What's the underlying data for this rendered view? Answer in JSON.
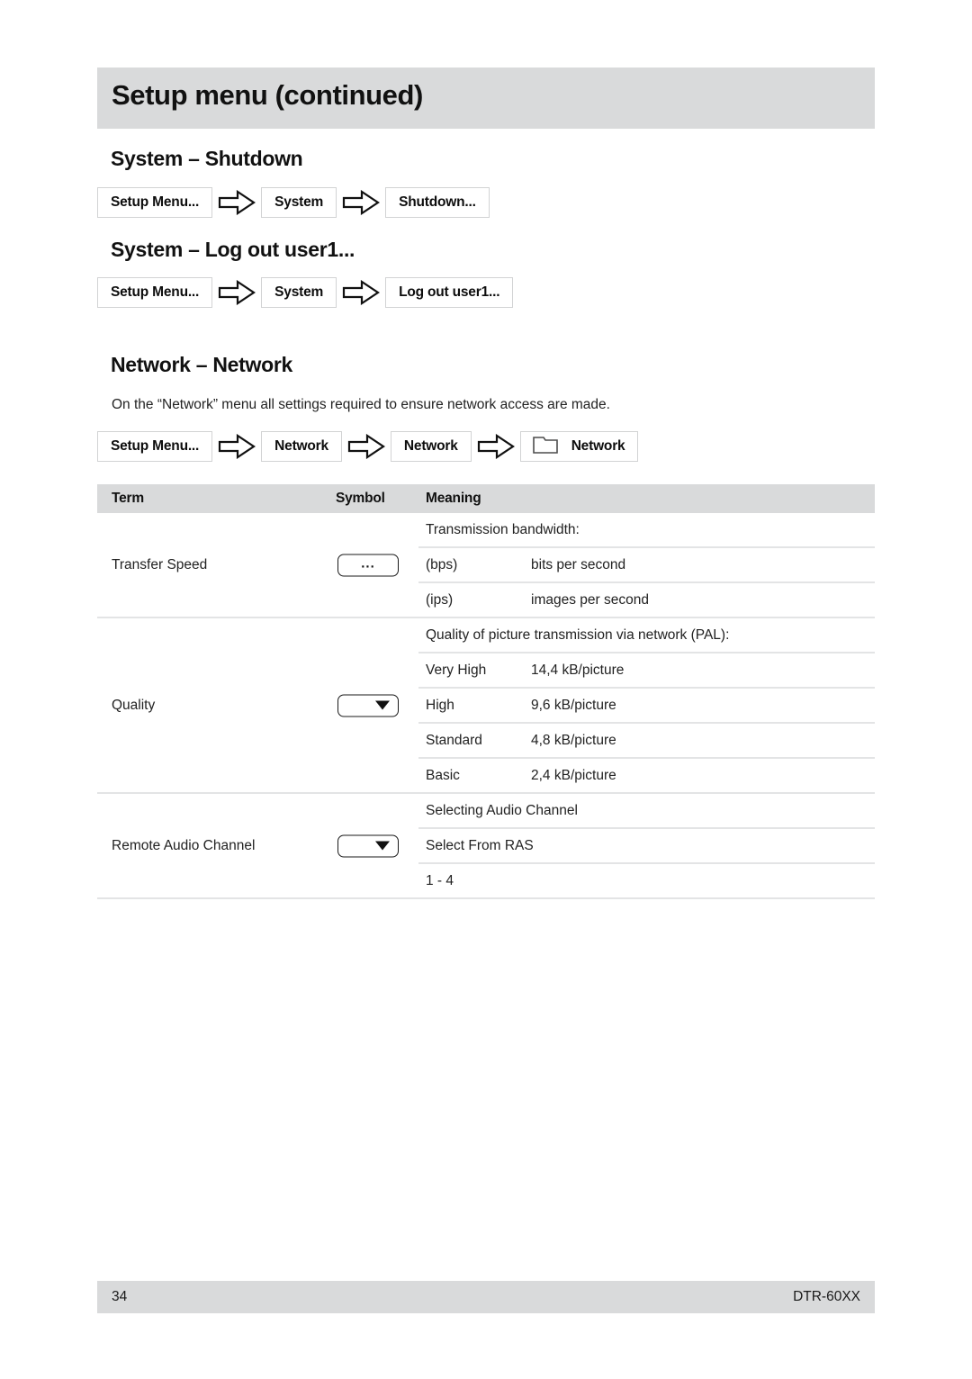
{
  "page": {
    "title": "Setup menu (continued)",
    "footer_page_number": "34",
    "footer_model": "DTR-60XX",
    "header_bg": "#d9dadb"
  },
  "sections": [
    {
      "heading": "System – Shutdown",
      "breadcrumb": [
        {
          "label": "Setup Menu...",
          "icon": ""
        },
        {
          "label": "System",
          "icon": ""
        },
        {
          "label": "Shutdown...",
          "icon": ""
        }
      ]
    },
    {
      "heading": "System – Log out user1...",
      "breadcrumb": [
        {
          "label": "Setup Menu...",
          "icon": ""
        },
        {
          "label": "System",
          "icon": ""
        },
        {
          "label": "Log out user1...",
          "icon": ""
        }
      ]
    },
    {
      "heading": "Network – Network",
      "intro": "On the “Network” menu all settings required to ensure network access are made.",
      "breadcrumb": [
        {
          "label": "Setup Menu...",
          "icon": ""
        },
        {
          "label": "Network",
          "icon": ""
        },
        {
          "label": "Network",
          "icon": ""
        },
        {
          "label": "Network",
          "icon": "folder-tab-icon"
        }
      ]
    }
  ],
  "table": {
    "headers": {
      "term": "Term",
      "symbol": "Symbol",
      "meaning": "Meaning"
    },
    "rows": [
      {
        "term": "Transfer Speed",
        "symbol_type": "ellipsis-button",
        "symbol_text": "...",
        "meaning_title": "Transmission bandwidth:",
        "items": [
          {
            "label": "(bps)",
            "value": "bits per second"
          },
          {
            "label": "(ips)",
            "value": "images per second"
          }
        ]
      },
      {
        "term": "Quality",
        "symbol_type": "dropdown",
        "symbol_text": "",
        "meaning_title": "Quality of picture transmission via network (PAL):",
        "items": [
          {
            "label": "Very High",
            "value": "14,4 kB/picture"
          },
          {
            "label": "High",
            "value": "9,6 kB/picture"
          },
          {
            "label": "Standard",
            "value": "4,8 kB/picture"
          },
          {
            "label": "Basic",
            "value": "2,4 kB/picture"
          }
        ]
      },
      {
        "term": "Remote Audio Channel",
        "symbol_type": "dropdown",
        "symbol_text": "",
        "meaning_title": "Selecting Audio Channel",
        "items": [
          {
            "label": "Select From RAS",
            "value": ""
          },
          {
            "label": "1 - 4",
            "value": ""
          }
        ]
      }
    ]
  }
}
